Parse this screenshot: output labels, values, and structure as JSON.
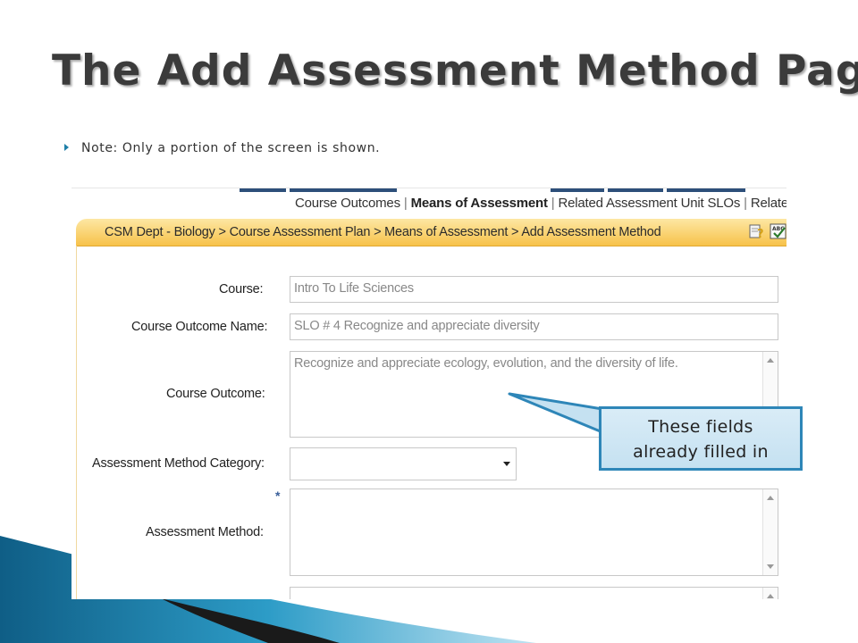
{
  "slide": {
    "title": "The Add Assessment Method Page",
    "note": "Note: Only a portion of the screen is shown."
  },
  "tabs": {
    "items": [
      {
        "label": "Course Outcomes",
        "active": false
      },
      {
        "label": "Means of Assessment",
        "active": true
      },
      {
        "label": "Related Assessment Unit SLOs",
        "active": false
      },
      {
        "label": "Related SLO",
        "active": false
      }
    ],
    "separator": "|"
  },
  "breadcrumb": {
    "text": "CSM Dept - Biology > Course Assessment Plan > Means of Assessment > Add Assessment Method"
  },
  "icons": {
    "help": "help-icon",
    "spellcheck": "spellcheck-icon",
    "spellcheck_text": "ABC"
  },
  "form": {
    "course": {
      "label": "Course:",
      "value": "Intro To Life Sciences"
    },
    "outcome_name": {
      "label": "Course Outcome Name:",
      "value": "SLO # 4 Recognize and appreciate diversity"
    },
    "outcome": {
      "label": "Course Outcome:",
      "value": "Recognize and appreciate ecology, evolution, and the diversity of life."
    },
    "category": {
      "label": "Assessment Method Category:",
      "value": ""
    },
    "method": {
      "label": "Assessment Method:",
      "value": "",
      "required_mark": "*"
    }
  },
  "callout": {
    "line1": "These fields",
    "line2": "already filled in"
  },
  "colors": {
    "accent": "#2e86b8",
    "breadcrumb_bar": "#f7c24a",
    "tab_marks": "#2d4f7a"
  }
}
